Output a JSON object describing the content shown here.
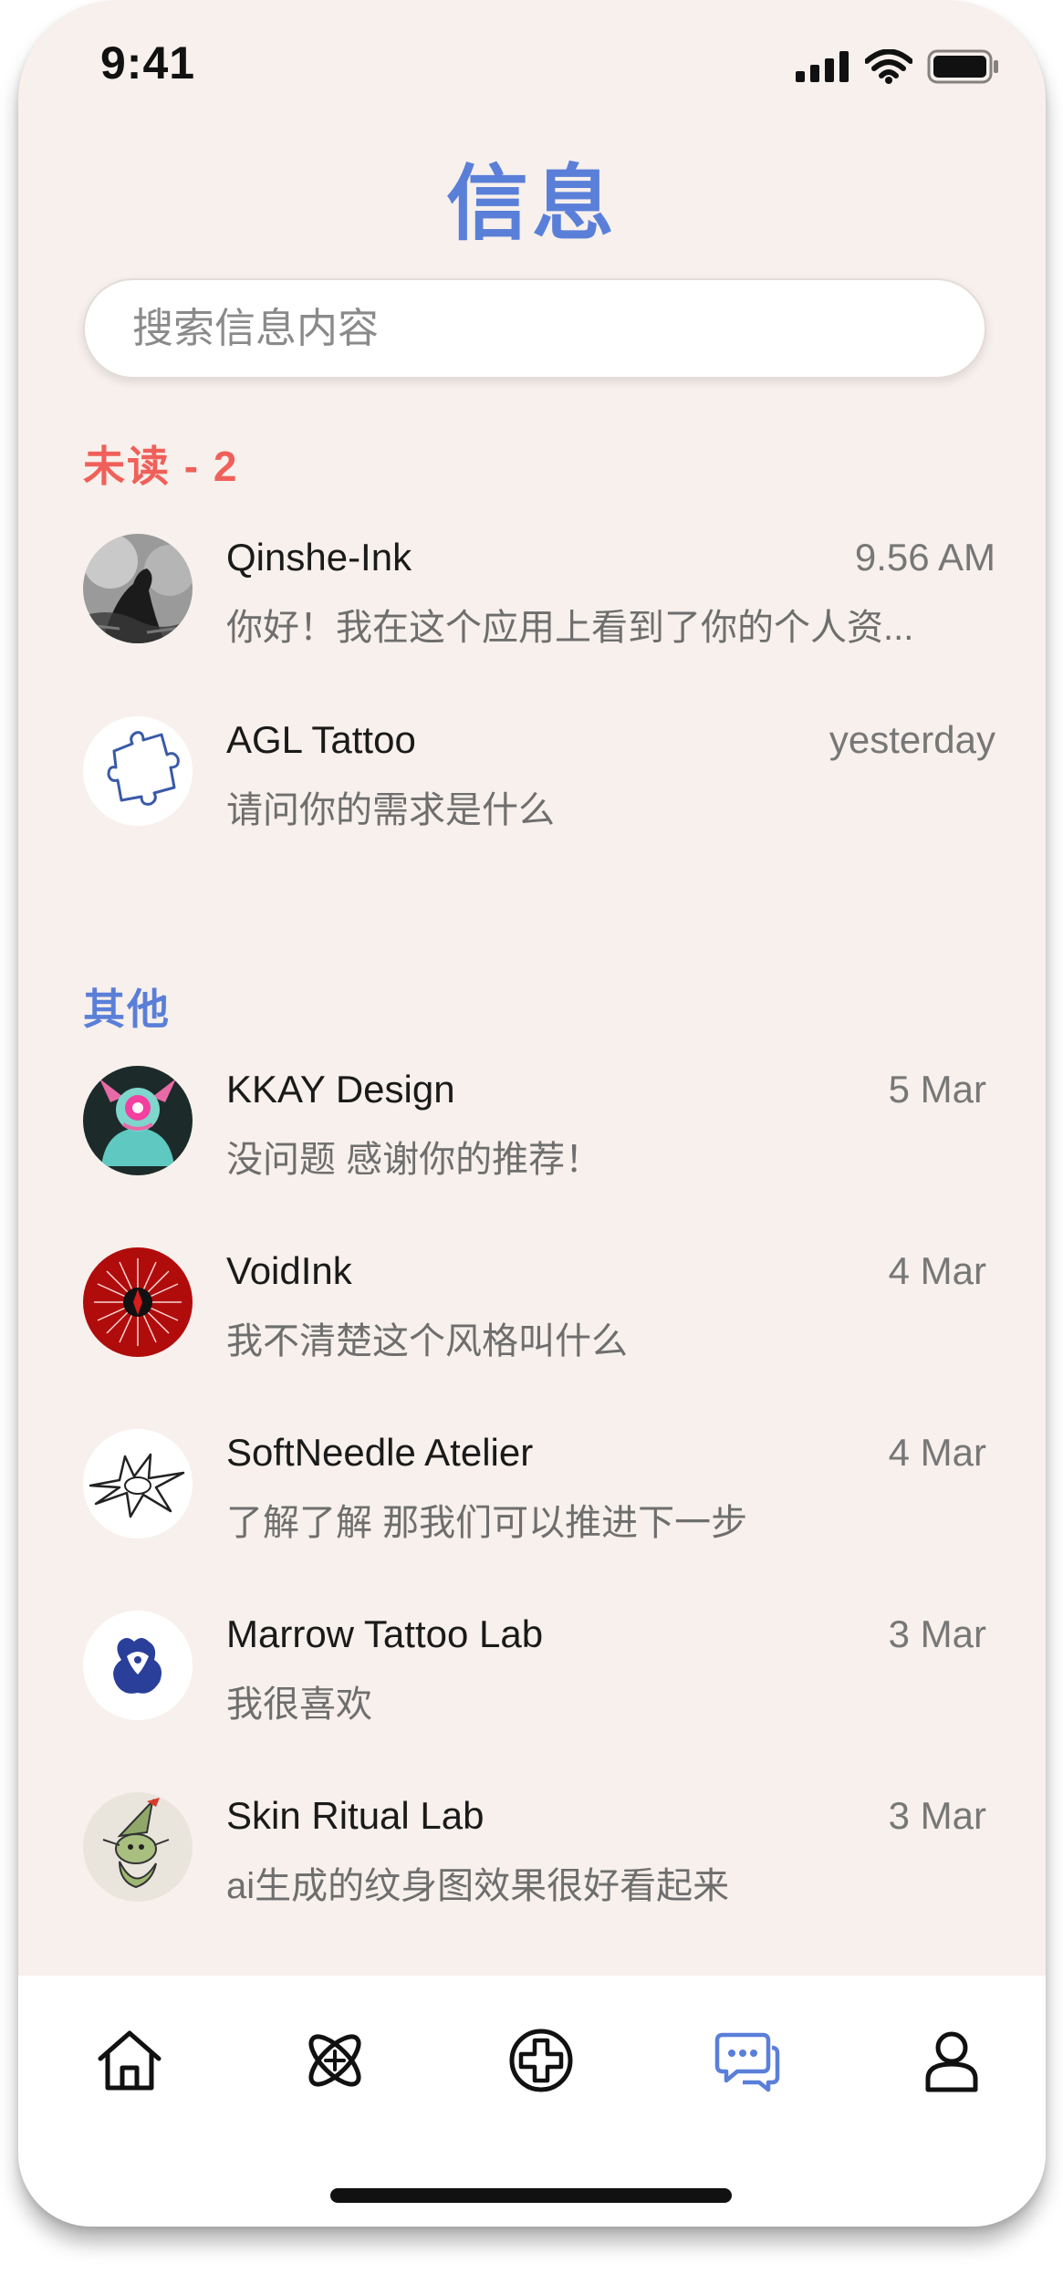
{
  "status": {
    "time": "9:41"
  },
  "title": "信息",
  "search": {
    "placeholder": "搜索信息内容",
    "value": ""
  },
  "sections": {
    "unread_label": "未读 - 2",
    "other_label": "其他"
  },
  "unread": [
    {
      "name": "Qinshe-Ink",
      "time": "9.56 AM",
      "preview": "你好！我在这个应用上看到了你的个人资...",
      "avatar": "ink-figure-avatar"
    },
    {
      "name": "AGL Tattoo",
      "time": "yesterday",
      "preview": "请问你的需求是什么",
      "avatar": "puzzle-avatar"
    }
  ],
  "others": [
    {
      "name": "KKAY Design",
      "time": "5 Mar",
      "preview": "没问题 感谢你的推荐！",
      "avatar": "neon-creature-avatar"
    },
    {
      "name": "VoidInk",
      "time": "4 Mar",
      "preview": "我不清楚这个风格叫什么",
      "avatar": "red-star-avatar"
    },
    {
      "name": "SoftNeedle Atelier",
      "time": "4 Mar",
      "preview": "了解了解 那我们可以推进下一步",
      "avatar": "thorn-avatar"
    },
    {
      "name": "Marrow Tattoo Lab",
      "time": "3 Mar",
      "preview": "我很喜欢",
      "avatar": "blue-creature-avatar"
    },
    {
      "name": "Skin Ritual Lab",
      "time": "3 Mar",
      "preview": "ai生成的纹身图效果很好看起来",
      "avatar": "goblin-sketch-avatar"
    }
  ],
  "tabs": [
    {
      "icon": "home-icon",
      "active": false
    },
    {
      "icon": "atom-icon",
      "active": false
    },
    {
      "icon": "add-circle-icon",
      "active": false
    },
    {
      "icon": "chat-icon",
      "active": true
    },
    {
      "icon": "profile-icon",
      "active": false
    }
  ],
  "colors": {
    "accent": "#5a7fd9",
    "unread": "#f0605a",
    "background": "#f7f0ec"
  }
}
